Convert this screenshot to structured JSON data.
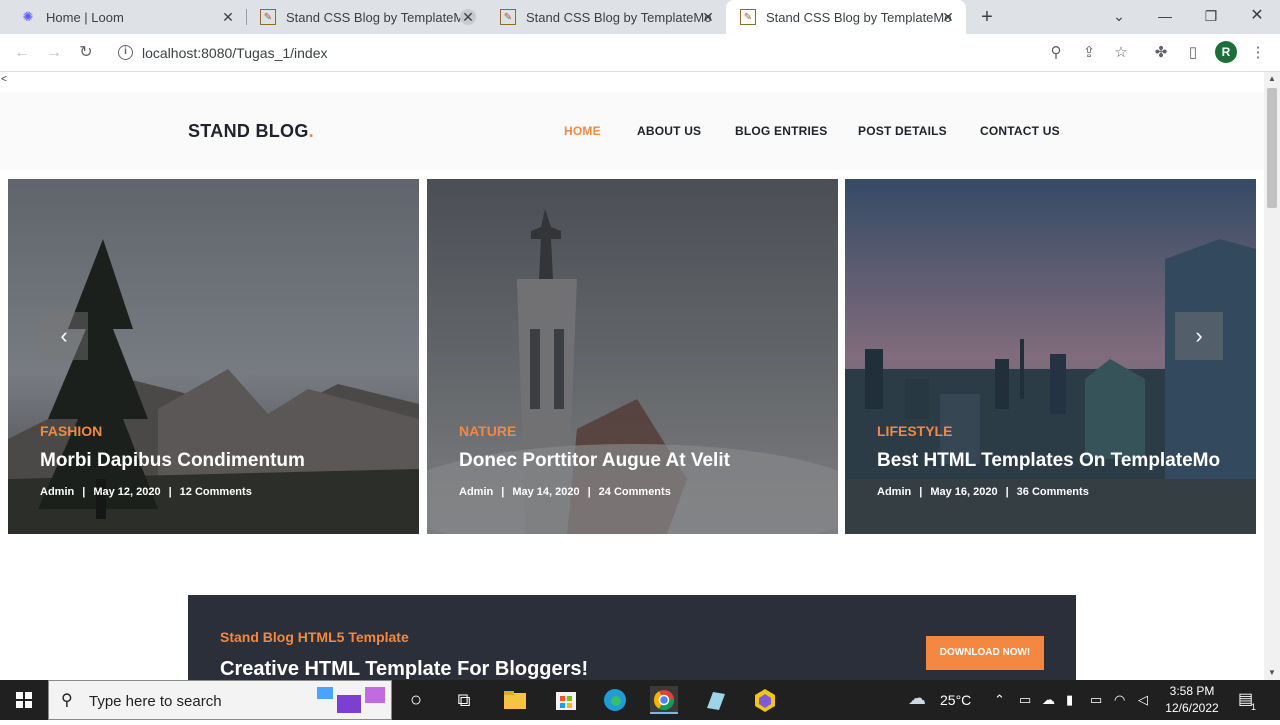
{
  "browser": {
    "tabs": [
      {
        "title": "Home | Loom",
        "active": false
      },
      {
        "title": "Stand CSS Blog by TemplateMo",
        "active": false
      },
      {
        "title": "Stand CSS Blog by TemplateMo",
        "active": false
      },
      {
        "title": "Stand CSS Blog by TemplateMo",
        "active": true
      }
    ],
    "url": "localhost:8080/Tugas_1/index",
    "profile_initial": "R"
  },
  "page": {
    "stray_char": "<",
    "brand": "STAND BLOG",
    "brand_dot": ".",
    "nav": [
      "HOME",
      "ABOUT US",
      "BLOG ENTRIES",
      "POST DETAILS",
      "CONTACT US"
    ],
    "slides": [
      {
        "category": "FASHION",
        "title": "Morbi Dapibus Condimentum",
        "author": "Admin",
        "date": "May 12, 2020",
        "comments": "12 Comments"
      },
      {
        "category": "NATURE",
        "title": "Donec Porttitor Augue At Velit",
        "author": "Admin",
        "date": "May 14, 2020",
        "comments": "24 Comments"
      },
      {
        "category": "LIFESTYLE",
        "title": "Best HTML Templates On TemplateMo",
        "author": "Admin",
        "date": "May 16, 2020",
        "comments": "36 Comments"
      }
    ],
    "separator": "|",
    "prev_arrow": "‹",
    "next_arrow": "›",
    "cta": {
      "subtitle": "Stand Blog HTML5 Template",
      "title": "Creative HTML Template For Bloggers!",
      "button": "DOWNLOAD NOW!"
    }
  },
  "taskbar": {
    "search_placeholder": "Type here to search",
    "temperature": "25°C",
    "time": "3:58 PM",
    "date": "12/6/2022",
    "notification_count": "1"
  },
  "colors": {
    "accent": "#f48840",
    "dark": "#20232e",
    "cta_bg": "#2b2f39"
  }
}
